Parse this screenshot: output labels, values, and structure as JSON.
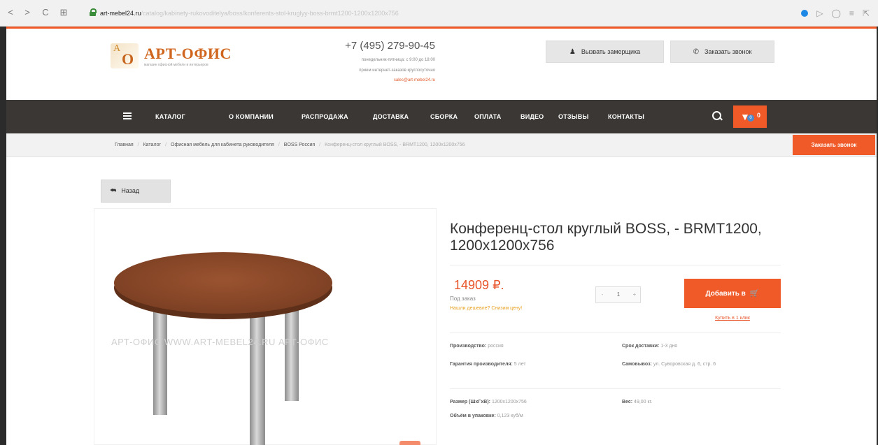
{
  "browser": {
    "url_domain": "art-mebel24.ru",
    "url_path": "/catalog/kabinety-rukovoditelya/boss/konferents-stol-kruglyy-boss-brmt1200-1200x1200x756",
    "back_glyph": "<",
    "forward_glyph": ">",
    "reload_glyph": "C",
    "apps_glyph": "⊞",
    "right_glyph_1": "▷",
    "right_glyph_2": "◯",
    "right_glyph_3": "≡",
    "right_glyph_4": "⇱"
  },
  "header": {
    "logo_title": "АРТ-ОФИС",
    "logo_sub": "магазин офисной мебели и интерьеров",
    "logo_letter_a": "A",
    "logo_letter_o": "O",
    "phone": "+7 (495) 279-90-45",
    "hours": "понедельник-пятница: с 9:00 до 18:00",
    "note": "прием интернет-заказов круглосуточно",
    "email": "sales@art-mebel24.ru",
    "btn_measurer": "Вызвать замерщика",
    "btn_callback": "Заказать звонок"
  },
  "nav": {
    "items": [
      "КАТАЛОГ",
      "О КОМПАНИИ",
      "РАСПРОДАЖА",
      "ДОСТАВКА",
      "СБОРКА",
      "ОПЛАТА",
      "ВИДЕО",
      "ОТЗЫВЫ",
      "КОНТАКТЫ"
    ],
    "cart_badge": "0",
    "cart_count": "0"
  },
  "breadcrumb": {
    "items": [
      "Главная",
      "Каталог",
      "Офисная мебель для кабинета руководителя",
      "BOSS Россия"
    ],
    "current": "Конференц-стол круглый BOSS, - BRMT1200, 1200x1200x756",
    "separator": "/"
  },
  "side_callback": "Заказать звонок",
  "back_button": "Назад",
  "image": {
    "watermark": "АРТ-ОФИС  WWW.ART-MEBEL24.RU  АРТ-ОФИС"
  },
  "product": {
    "title": "Конференц-стол круглый BOSS, - BRMT1200, 1200x1200x756",
    "price": "14909",
    "currency": "₽.",
    "stock": "Под заказ",
    "cheaper_link": "Нашли дешевле? Снизим цену!",
    "qty_minus": "-",
    "qty_value": "1",
    "qty_plus": "+",
    "add_button": "Добавить в",
    "one_click": "Купить в 1 клик",
    "specs": {
      "manufacturer_label": "Производство:",
      "manufacturer_value": "россия",
      "delivery_label": "Срок доставки:",
      "delivery_value": "1-3 дня",
      "warranty_label": "Гарантия производителя:",
      "warranty_value": "5 лет",
      "pickup_label": "Самовывоз:",
      "pickup_value": "ул. Суворовская д. 6, стр. 6",
      "size_label": "Размер (ШхГхВ):",
      "size_value": "1200x1200x756",
      "weight_label": "Вес:",
      "weight_value": "49,00 кг.",
      "volume_label": "Объём в упаковке:",
      "volume_value": "0,123 куб/м"
    }
  },
  "colors": {
    "accent": "#f05a28",
    "nav_bg": "#3b3734",
    "tabletop": "#8b4a2b",
    "legs": "#b8b8b8"
  }
}
